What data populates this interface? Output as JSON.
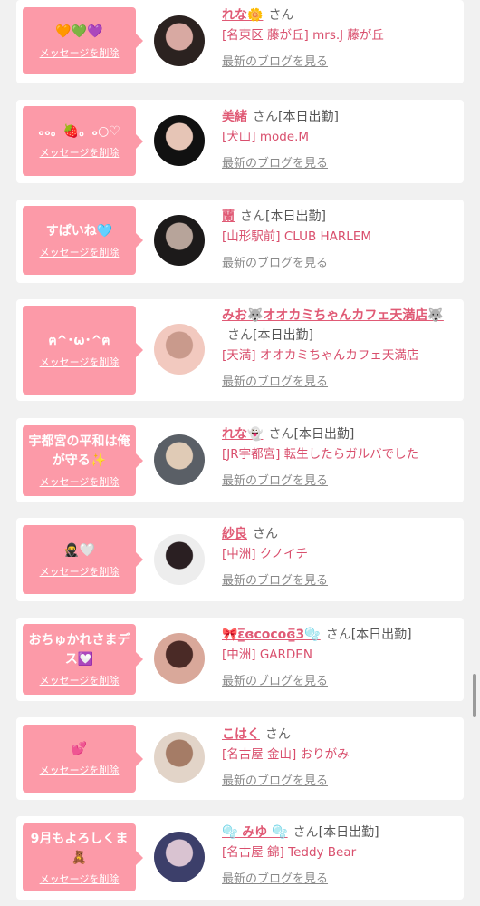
{
  "delete_label": "メッセージを削除",
  "blog_label": "最新のブログを見る",
  "san_label": "さん",
  "items": [
    {
      "message": "🧡💚💜",
      "name": "れな🌼",
      "status": "",
      "shop": "[名東区 藤が丘] mrs.J 藤が丘",
      "avatar_colors": [
        "#2b2220",
        "#d8a9a2"
      ]
    },
    {
      "message": "ₒₒ。🍓。ₒ○♡",
      "name": "美緒",
      "status": "[本日出勤]",
      "shop": "[犬山] mode.M",
      "avatar_colors": [
        "#111111",
        "#e6c5b6"
      ]
    },
    {
      "message": "すぱいね🩵",
      "name": "蘭",
      "status": "[本日出勤]",
      "shop": "[山形駅前] CLUB HARLEM",
      "avatar_colors": [
        "#1c1a1a",
        "#b7a49a"
      ]
    },
    {
      "message": "ฅ^･ω･^ฅ",
      "name": "みお🐺オオカミちゃんカフェ天満店🐺",
      "status": "[本日出勤]",
      "shop": "[天満] オオカミちゃんカフェ天満店",
      "avatar_colors": [
        "#f2c9bf",
        "#c99a8c"
      ]
    },
    {
      "message": "宇都宮の平和は俺が守る✨",
      "name": "れな👻",
      "status": "[本日出勤]",
      "shop": "[JR宇都宮] 転生したらガルバでした",
      "avatar_colors": [
        "#5a5f66",
        "#e0cbb6"
      ]
    },
    {
      "message": "🥷🤍",
      "name": "紗良",
      "status": "",
      "shop": "[中洲] クノイチ",
      "avatar_colors": [
        "#ededed",
        "#2a1f22"
      ]
    },
    {
      "message": "おちゅかれさまデス💟",
      "name": "🎀ɛ̲̅ɞcocoɞ̲̅3🫧",
      "status": "[本日出勤]",
      "shop": "[中洲] GARDEN",
      "avatar_colors": [
        "#d9a89a",
        "#4a2a26"
      ]
    },
    {
      "message": "💕",
      "name": "こはく",
      "status": "",
      "shop": "[名古屋 金山] おりがみ",
      "avatar_colors": [
        "#e2d4c8",
        "#a57c66"
      ]
    },
    {
      "message": "9月もよろしくま🧸",
      "name": "🫧 みゆ 🫧",
      "status": "[本日出勤]",
      "shop": "[名古屋 錦] Teddy Bear",
      "avatar_colors": [
        "#3c3f6a",
        "#d9c3d1"
      ]
    }
  ]
}
